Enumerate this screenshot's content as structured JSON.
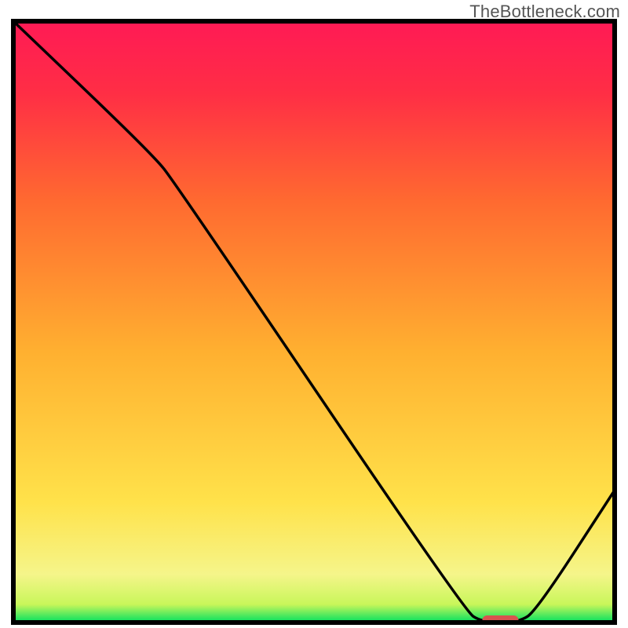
{
  "watermark": "TheBottleneck.com",
  "chart_data": {
    "type": "line",
    "note": "Bottleneck percentage curve over a gradient background. X axis is normalized position (0–100), Y is bottleneck percentage (0=good/green, 100=bad/red). An optimal red pill marker sits at the curve minimum.",
    "xlim": [
      0,
      100
    ],
    "ylim": [
      0,
      100
    ],
    "xlabel": "",
    "ylabel": "",
    "gradient_stops": [
      {
        "pos": 0.0,
        "color": "#00e060"
      },
      {
        "pos": 0.03,
        "color": "#c8f65a"
      },
      {
        "pos": 0.08,
        "color": "#f5f58a"
      },
      {
        "pos": 0.2,
        "color": "#ffe24a"
      },
      {
        "pos": 0.45,
        "color": "#ffb030"
      },
      {
        "pos": 0.7,
        "color": "#ff6a30"
      },
      {
        "pos": 0.88,
        "color": "#ff2e45"
      },
      {
        "pos": 1.0,
        "color": "#ff1a55"
      }
    ],
    "series": [
      {
        "name": "bottleneck-curve",
        "points": [
          {
            "x": 0,
            "y": 100
          },
          {
            "x": 23,
            "y": 78
          },
          {
            "x": 27,
            "y": 73
          },
          {
            "x": 75,
            "y": 2
          },
          {
            "x": 78,
            "y": 0
          },
          {
            "x": 84,
            "y": 0
          },
          {
            "x": 87,
            "y": 2
          },
          {
            "x": 100,
            "y": 22
          }
        ]
      }
    ],
    "optimal_marker": {
      "x_start": 78,
      "x_end": 84,
      "y": 0,
      "color": "#d9534f"
    },
    "border_width": 6,
    "border_color": "#000000"
  }
}
